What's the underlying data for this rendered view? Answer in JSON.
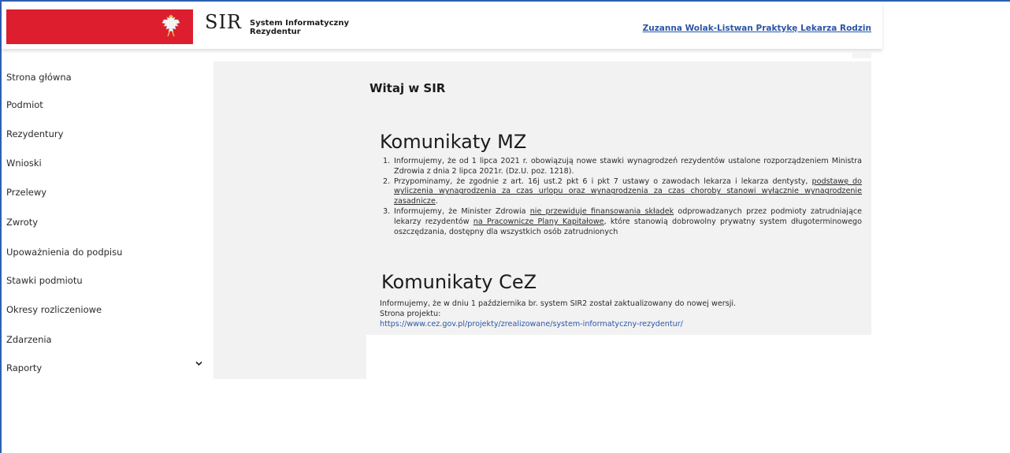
{
  "header": {
    "logo_main": "SIR",
    "logo_line1": "System Informatyczny",
    "logo_line2": "Rezydentur",
    "user_link": "Zuzanna Wolak-Listwan Praktykę Lekarza Rodzin",
    "brand_red": "#dc1e2e",
    "link_color": "#2b55a8"
  },
  "sidebar": {
    "items": [
      {
        "label": "Strona główna"
      },
      {
        "label": "Podmiot"
      },
      {
        "label": "Rezydentury"
      },
      {
        "label": "Wnioski"
      },
      {
        "label": "Przelewy"
      },
      {
        "label": "Zwroty"
      },
      {
        "label": "Upoważnienia do podpisu"
      },
      {
        "label": "Stawki podmiotu"
      },
      {
        "label": "Okresy rozliczeniowe"
      },
      {
        "label": "Zdarzenia"
      },
      {
        "label": "Raporty"
      }
    ],
    "expand_icon": "chevron-down-icon"
  },
  "main": {
    "welcome": "Witaj w SIR",
    "mz": {
      "title": "Komunikaty MZ",
      "items": [
        {
          "num": "1.",
          "text": "Informujemy, że od 1 lipca 2021 r. obowiązują nowe stawki wynagrodzeń rezydentów ustalone rozporządzeniem Ministra Zdrowia z dnia 2 lipca 2021r. (Dz.U. poz. 1218)."
        },
        {
          "num": "2.",
          "text_before": "Przypominamy, że zgodnie z art. 16j ust.2 pkt 6 i pkt 7 ustawy o zawodach lekarza i lekarza dentysty, ",
          "text_underlined": "podstawę do wyliczenia wynagrodzenia za czas urlopu oraz wynagrodzenia za czas choroby stanowi wyłącznie wynagrodzenie zasadnicze",
          "text_after": "."
        },
        {
          "num": "3.",
          "text_a": "Informujemy, że Minister Zdrowia ",
          "text_u1": "nie przewiduje finansowania składek",
          "text_b": " odprowadzanych przez podmioty zatrudniające lekarzy rezydentów ",
          "text_u2": "na Pracownicze Plany Kapitałowe",
          "text_c": ", które stanowią dobrowolny prywatny system długoterminowego oszczędzania, dostępny dla wszystkich osób zatrudnionych"
        }
      ]
    },
    "cez": {
      "title": "Komunikaty CeZ",
      "line1": "Informujemy, że w dniu 1 października br. system SIR2 został zaktualizowany do nowej wersji.",
      "line2": "Strona projektu:",
      "link": "https://www.cez.gov.pl/projekty/zrealizowane/system-informatyczny-rezydentur/"
    }
  }
}
